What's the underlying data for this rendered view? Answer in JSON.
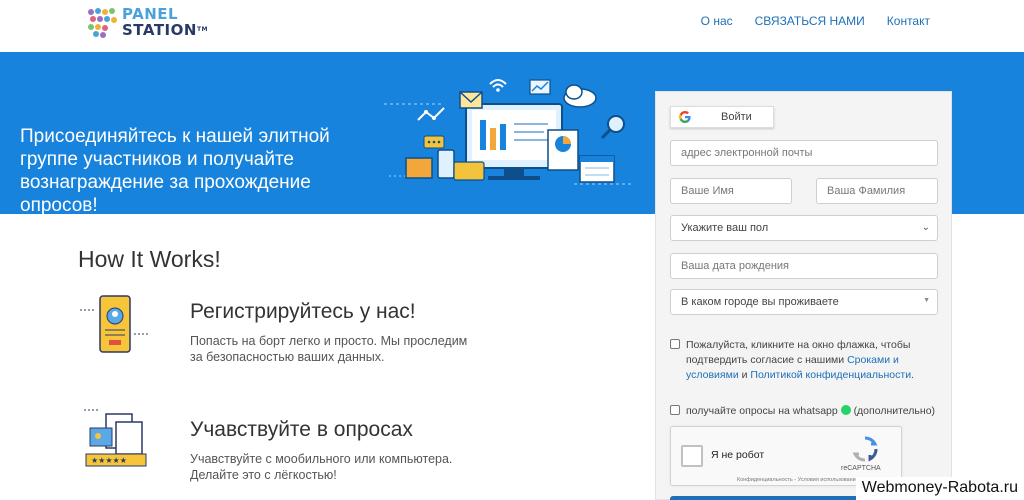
{
  "header": {
    "logo": {
      "line1": "PANEL",
      "line2": "STATION",
      "tm": "TM"
    },
    "nav": [
      {
        "label": "О нас"
      },
      {
        "label": "СВЯЗАТЬСЯ НАМИ"
      },
      {
        "label": "Контакт"
      }
    ]
  },
  "hero": {
    "text": "Присоединяйтесь к нашей элитной группе участников и получайте вознаграждение за прохождение опросов!"
  },
  "form": {
    "google_button": "Войти",
    "email_placeholder": "адрес электронной почты",
    "first_name_placeholder": "Ваше Имя",
    "last_name_placeholder": "Ваша Фамилия",
    "gender_select": "Укажите ваш пол",
    "birthdate_placeholder": "Ваша дата рождения",
    "city_select": "В каком городе вы проживаете",
    "consent": {
      "text1": "Пожалуйста, кликните на окно флажка, чтобы",
      "text2": "подтвердить согласие с нашими",
      "link_terms_a": "Сроками и",
      "link_terms_b": "условиями",
      "and": "и",
      "link_privacy": "Политикой конфиденциальности",
      "dot": "."
    },
    "whatsapp": {
      "text_before": "получайте опросы на whatsapp",
      "text_after": "(дополнительно)"
    },
    "recaptcha": {
      "label": "Я не робот",
      "brand": "reCAPTCHA",
      "terms": "Конфиденциальность - Условия использования"
    }
  },
  "how": {
    "title": "How It Works!",
    "steps": [
      {
        "title": "Регистрируйтесь у нас!",
        "desc_line1": "Попасть на борт легко и просто. Мы проследим",
        "desc_line2": "за безопасностью ваших данных."
      },
      {
        "title": "Учавствуйте в опросах",
        "desc_line1": "Учавствуйте с мообильного или компьютера.",
        "desc_line2": "Делайте это с лёгкостью!"
      }
    ]
  },
  "watermark": "Webmoney-Rabota.ru",
  "colors": {
    "hero_blue": "#1783dc",
    "link_blue": "#1e6fb8",
    "panel_bg": "#f4f4f4"
  }
}
